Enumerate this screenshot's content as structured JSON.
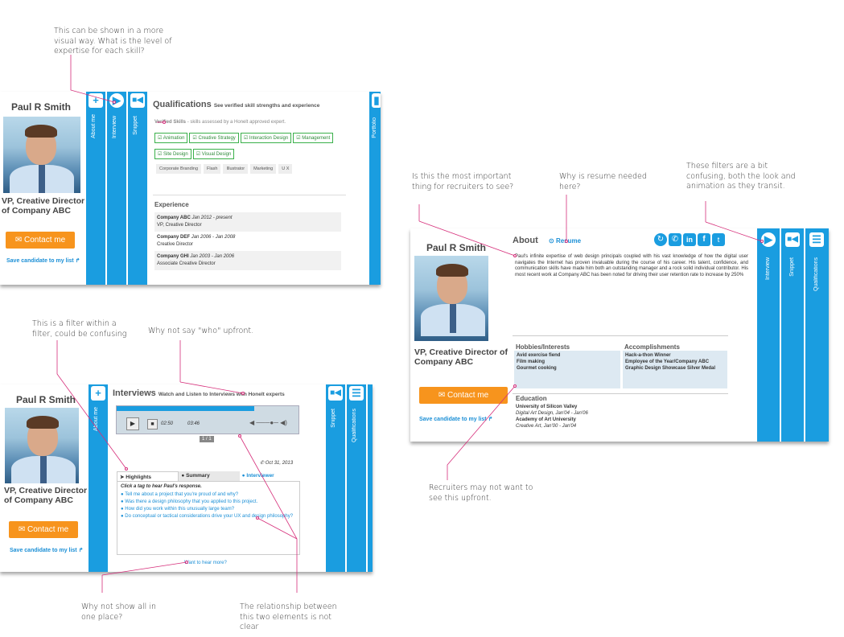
{
  "notes": {
    "n1": "This can be shown in a more visual way. What is the level of expertise for each skill?",
    "n2": "Is this the most important thing for recruiters to see?",
    "n3": "Why is resume needed here?",
    "n4": "These filters are a bit confusing, both the look and animation as they transit.",
    "n5": "This is a filter within a filter, could be confusing",
    "n6": "Why not say \"who\" upfront.",
    "n7": "Recruiters may not want to see this upfront.",
    "n8": "Why not show all in one place?",
    "n9": "The relationship between this two elements is not clear"
  },
  "profile": {
    "name": "Paul R Smith",
    "title": "VP, Creative Director of Company ABC",
    "contact": "Contact me",
    "save": "Save candidate to my list"
  },
  "tabs": {
    "about": "About me",
    "interview": "Interview",
    "snippet": "Snippet",
    "qualifications": "Qualifications",
    "portfolio": "Portfolio"
  },
  "quals": {
    "title": "Qualifications",
    "subtitle": "See verified skill strengths and experience",
    "verified_label": "Verified Skills",
    "verified_desc": " - skills assessed by a Honelt approved expert.",
    "verified": [
      "Animation",
      "Creative Strategy",
      "Interaction Design",
      "Management",
      "Site Design",
      "Visual Design"
    ],
    "other": [
      "Corporate Branding",
      "Flash",
      "Illustrator",
      "Marketing",
      "U X"
    ],
    "exp_title": "Experience",
    "exp": [
      {
        "company": "Company ABC",
        "dates": "Jan 2012 - present",
        "role": "VP, Creative Director"
      },
      {
        "company": "Company DEF",
        "dates": "Jan 2006 - Jan 2008",
        "role": "Creative Director"
      },
      {
        "company": "Company GHI",
        "dates": "Jan 2003 - Jan 2006",
        "role": "Associate Creative Director"
      }
    ]
  },
  "interviews": {
    "title": "Interviews",
    "subtitle": "Watch and Listen to Interviews with Honelt experts",
    "time_cur": "02:50",
    "time_total": "03:46",
    "page": "1 / 1",
    "date": "Oct 31, 2013",
    "tabs": [
      "Highlights",
      "Summary",
      "Interviewer"
    ],
    "prompt": "Click a tag to hear Paul's response.",
    "questions": [
      "Tell me about a project that you're proud of and why?",
      "Was there a design philosophy that you applied to this project.",
      "How did you work within this unusually large team?",
      "Do conceptual or tactical considerations drive your UX and design philosophy?"
    ],
    "more": "Want to hear more?"
  },
  "about": {
    "title": "About",
    "resume": "Resume",
    "bio": "Paul's infinite expertise of web design principals coupled with his vast knowledge of how the digital user navigates the Internet has proven invaluable during the course of his career. His talent, confidence, and communication skills have made him both an outstanding manager and a rock solid individual contributor. His most recent work at Company ABC has been noted for driving their user retention rate to increase by 250%",
    "hobbies_title": "Hobbies/Interests",
    "hobbies": [
      "Avid exercise fiend",
      "Film making",
      "Gourmet cooking"
    ],
    "acc_title": "Accomplishments",
    "acc": [
      "Hack-a-thon Winner",
      "Employee of the Year/Company ABC",
      "Graphic Design Showcase Silver Medal"
    ],
    "edu_title": "Education",
    "edu": [
      {
        "school": "University of Silicon Valley",
        "detail": "Digital Art Design, Jan'04 - Jan'06"
      },
      {
        "school": "Academy of Art University",
        "detail": "Creative Art, Jan'00 - Jan'04"
      }
    ]
  },
  "colors": {
    "blue": "#1a9de0",
    "orange": "#f7941d",
    "green": "#3ab04a",
    "annotation": "#d62e7a"
  }
}
